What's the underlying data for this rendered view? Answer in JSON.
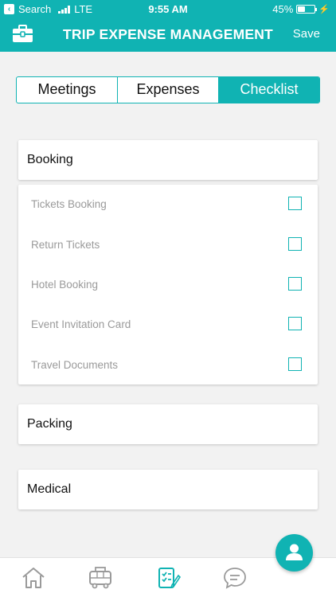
{
  "status": {
    "back_label": "Search",
    "carrier": "LTE",
    "time": "9:55 AM",
    "battery": "45%",
    "battery_level": 0.45
  },
  "header": {
    "title": "TRIP EXPENSE MANAGEMENT",
    "save_label": "Save",
    "icon": "briefcase-icon"
  },
  "tabs": [
    {
      "label": "Meetings",
      "active": false
    },
    {
      "label": "Expenses",
      "active": false
    },
    {
      "label": "Checklist",
      "active": true
    }
  ],
  "sections": {
    "booking": {
      "title": "Booking",
      "items": [
        {
          "label": "Tickets Booking",
          "checked": false
        },
        {
          "label": "Return Tickets",
          "checked": false
        },
        {
          "label": "Hotel Booking",
          "checked": false
        },
        {
          "label": "Event Invitation Card",
          "checked": false
        },
        {
          "label": "Travel Documents",
          "checked": false
        }
      ]
    },
    "packing": {
      "title": "Packing"
    },
    "medical": {
      "title": "Medical"
    }
  },
  "bottom_nav": [
    "home-icon",
    "bus-icon",
    "checklist-icon",
    "chat-icon"
  ],
  "colors": {
    "accent": "#10b3b3",
    "background": "#f2f2f2"
  }
}
